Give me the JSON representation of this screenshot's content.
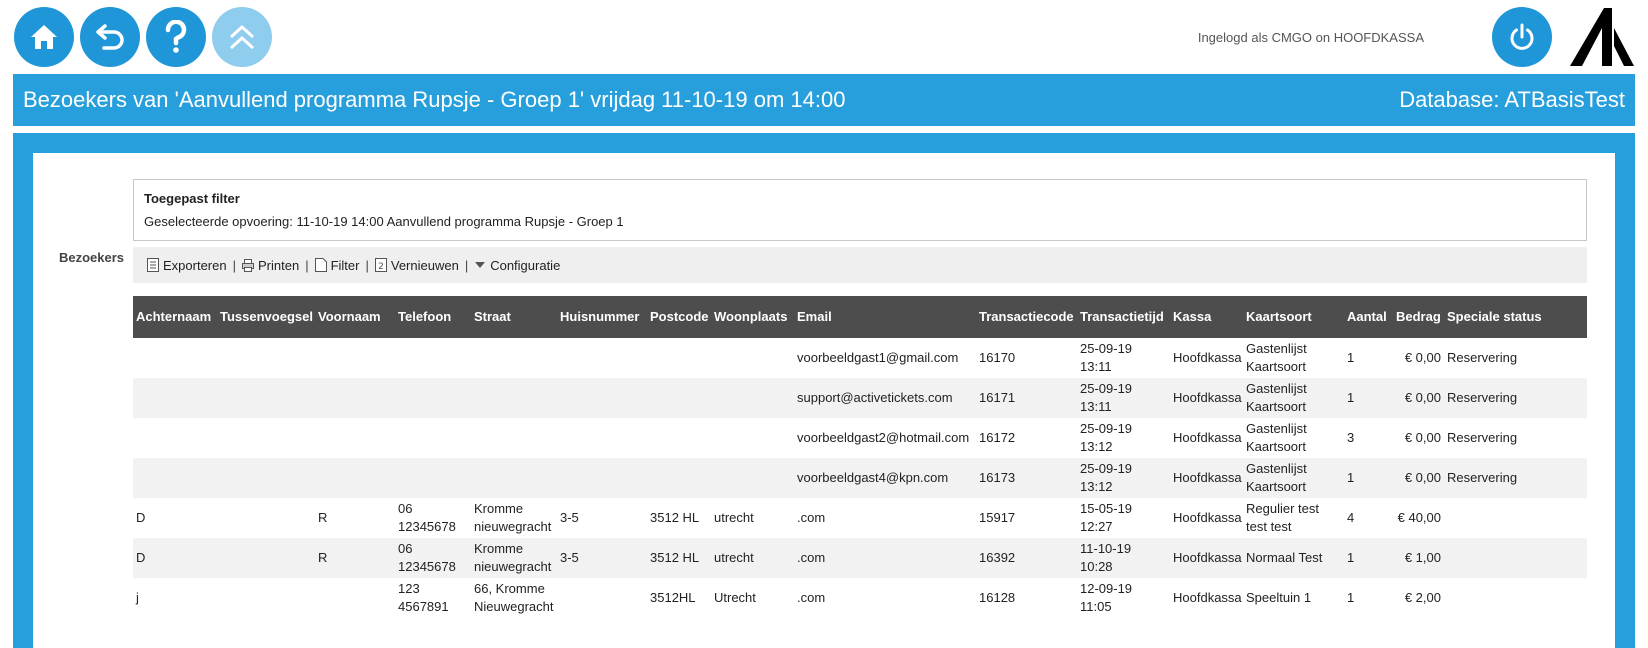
{
  "nav": {
    "home_icon": "home-icon",
    "back_icon": "undo-icon",
    "help_icon": "question-icon",
    "up_icon": "double-chevron-up-icon",
    "login_text": "Ingelogd als CMGO on HOOFDKASSA",
    "power_icon": "power-icon"
  },
  "header": {
    "title": "Bezoekers van 'Aanvullend programma Rupsje - Groep 1' vrijdag 11-10-19 om 14:00",
    "database": "Database: ATBasisTest"
  },
  "filter": {
    "title": "Toegepast filter",
    "text": "Geselecteerde opvoering:  11-10-19 14:00 Aanvullend programma Rupsje - Groep 1"
  },
  "section_label": "Bezoekers",
  "toolbar": {
    "export": "Exporteren",
    "print": "Printen",
    "filter": "Filter",
    "refresh": "Vernieuwen",
    "config": "Configuratie",
    "separator": "|"
  },
  "table": {
    "headers": [
      "Achternaam",
      "Tussenvoegsel",
      "Voornaam",
      "Telefoon",
      "Straat",
      "Huisnummer",
      "Postcode",
      "Woonplaats",
      "Email",
      "Transactiecode",
      "Transactietijd",
      "Kassa",
      "Kaartsoort",
      "Aantal",
      "Bedrag",
      "Speciale status"
    ],
    "rows": [
      [
        "",
        "",
        "",
        "",
        "",
        "",
        "",
        "",
        "voorbeeldgast1@gmail.com",
        "16170",
        "25-09-19 13:11",
        "Hoofdkassa",
        "Gastenlijst Kaartsoort",
        "1",
        "€ 0,00",
        "Reservering"
      ],
      [
        "",
        "",
        "",
        "",
        "",
        "",
        "",
        "",
        "support@activetickets.com",
        "16171",
        "25-09-19 13:11",
        "Hoofdkassa",
        "Gastenlijst Kaartsoort",
        "1",
        "€ 0,00",
        "Reservering"
      ],
      [
        "",
        "",
        "",
        "",
        "",
        "",
        "",
        "",
        "voorbeeldgast2@hotmail.com",
        "16172",
        "25-09-19 13:12",
        "Hoofdkassa",
        "Gastenlijst Kaartsoort",
        "3",
        "€ 0,00",
        "Reservering"
      ],
      [
        "",
        "",
        "",
        "",
        "",
        "",
        "",
        "",
        "voorbeeldgast4@kpn.com",
        "16173",
        "25-09-19 13:12",
        "Hoofdkassa",
        "Gastenlijst Kaartsoort",
        "1",
        "€ 0,00",
        "Reservering"
      ],
      [
        "D",
        "",
        "R",
        "06 12345678",
        "Kromme nieuwegracht",
        "3-5",
        "3512 HL",
        "utrecht",
        ".com",
        "15917",
        "15-05-19 12:27",
        "Hoofdkassa",
        "Regulier test test test",
        "4",
        "€ 40,00",
        ""
      ],
      [
        "D",
        "",
        "R",
        "06 12345678",
        "Kromme nieuwegracht",
        "3-5",
        "3512 HL",
        "utrecht",
        ".com",
        "16392",
        "11-10-19 10:28",
        "Hoofdkassa",
        "Normaal Test",
        "1",
        "€ 1,00",
        ""
      ],
      [
        "j",
        "",
        "",
        "123 4567891",
        "66, Kromme Nieuwegracht",
        "",
        "3512HL",
        "Utrecht",
        ".com",
        "16128",
        "12-09-19 11:05",
        "Hoofdkassa",
        "Speeltuin 1",
        "1",
        "€ 2,00",
        ""
      ]
    ]
  }
}
